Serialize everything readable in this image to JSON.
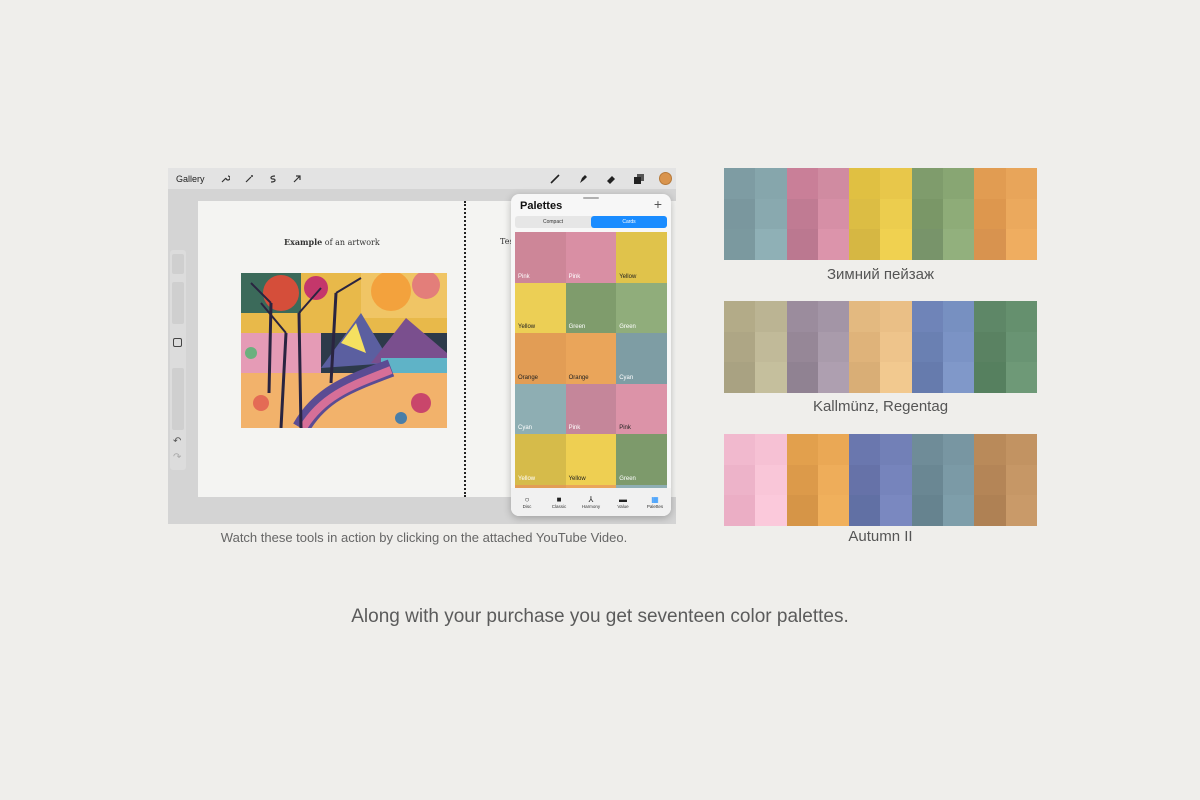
{
  "toolbar": {
    "gallery_label": "Gallery",
    "current_color": "#d9944d"
  },
  "canvas": {
    "caption_bold": "Example",
    "caption_rest": " of an artwork",
    "caption_right": "Tes"
  },
  "palettes_panel": {
    "title": "Palettes",
    "add_icon": "plus-icon",
    "view_modes": [
      "Compact",
      "Cards"
    ],
    "active_view": "Cards",
    "cards": [
      {
        "label": "Pink",
        "color": "#cd8698",
        "text": "#ffffff"
      },
      {
        "label": "Pink",
        "color": "#d98fa4",
        "text": "#ffffff"
      },
      {
        "label": "Yellow",
        "color": "#e0c34b",
        "text": "#222222"
      },
      {
        "label": "Yellow",
        "color": "#eccf55",
        "text": "#222222"
      },
      {
        "label": "Green",
        "color": "#7f9c6c",
        "text": "#ffffff"
      },
      {
        "label": "Green",
        "color": "#90ad7b",
        "text": "#ffffff"
      },
      {
        "label": "Orange",
        "color": "#e29d55",
        "text": "#222222"
      },
      {
        "label": "Orange",
        "color": "#eaa55a",
        "text": "#222222"
      },
      {
        "label": "Cyan",
        "color": "#7e9da4",
        "text": "#ffffff"
      },
      {
        "label": "Cyan",
        "color": "#8eaeb3",
        "text": "#ffffff"
      },
      {
        "label": "Pink",
        "color": "#c5869a",
        "text": "#ffffff"
      },
      {
        "label": "Pink",
        "color": "#dc93a8",
        "text": "#222222"
      },
      {
        "label": "Yellow",
        "color": "#d6bb4a",
        "text": "#ffffff"
      },
      {
        "label": "Yellow",
        "color": "#eecf52",
        "text": "#222222"
      },
      {
        "label": "Green",
        "color": "#7d9a6b",
        "text": "#ffffff"
      },
      {
        "label": "",
        "color": "#e29d55",
        "text": "#222222"
      },
      {
        "label": "",
        "color": "#eaa55a",
        "text": "#222222"
      },
      {
        "label": "",
        "color": "#8eaeb3",
        "text": "#222222"
      }
    ],
    "tabs": [
      {
        "label": "Disc",
        "icon": "disc-icon",
        "glyph": "○"
      },
      {
        "label": "Classic",
        "icon": "classic-icon",
        "glyph": "■"
      },
      {
        "label": "Harmony",
        "icon": "harmony-icon",
        "glyph": "⅄"
      },
      {
        "label": "Value",
        "icon": "value-icon",
        "glyph": "▬"
      },
      {
        "label": "Palettes",
        "icon": "palettes-icon",
        "glyph": "▦"
      }
    ],
    "active_tab": "Palettes"
  },
  "video_caption": "Watch these tools in action by clicking on the attached YouTube Video.",
  "palettes": [
    {
      "name": "Зимний пейзаж",
      "groups": [
        [
          "#7e9ca3",
          "#86a6ac",
          "#7a979e",
          "#89a9af",
          "#7b999f",
          "#8fb0b6"
        ],
        [
          "#c97f98",
          "#d08ba1",
          "#c07b93",
          "#d68fa6",
          "#bb7890",
          "#dc94ab"
        ],
        [
          "#e0c042",
          "#e8c74a",
          "#dcbd44",
          "#eccd4e",
          "#d6b743",
          "#f0d150"
        ],
        [
          "#7f9c6c",
          "#88a673",
          "#7a9767",
          "#8eac78",
          "#78946a",
          "#92b07d"
        ],
        [
          "#e19c52",
          "#e8a55a",
          "#dd974e",
          "#eba95d",
          "#d8934f",
          "#efad60"
        ]
      ]
    },
    {
      "name": "Kallmünz, Regentag",
      "groups": [
        [
          "#b3ab88",
          "#bbb493",
          "#aea685",
          "#c1ba99",
          "#a9a282",
          "#c5bf9d"
        ],
        [
          "#9b8c9d",
          "#a395a6",
          "#968797",
          "#a99bab",
          "#908292",
          "#ae9fb0"
        ],
        [
          "#e3b980",
          "#eabf86",
          "#dfb37a",
          "#eec48b",
          "#d9ae76",
          "#f2c98f"
        ],
        [
          "#6f84b8",
          "#7790c1",
          "#6a80b2",
          "#7b93c5",
          "#667bad",
          "#8098c9"
        ],
        [
          "#5e8767",
          "#65906e",
          "#5a8262",
          "#699473",
          "#56805f",
          "#6e9977"
        ]
      ]
    },
    {
      "name": "Autumn II",
      "groups": [
        [
          "#f1b9ce",
          "#f6c1d4",
          "#edb3c9",
          "#f9c6d8",
          "#ebaec5",
          "#fbc9db"
        ],
        [
          "#e2a04d",
          "#eaa855",
          "#dc9a4a",
          "#eead5a",
          "#d69547",
          "#f0b05c"
        ],
        [
          "#6a77ae",
          "#7280b7",
          "#6672a8",
          "#7684bc",
          "#6170a4",
          "#7a88c0"
        ],
        [
          "#6f8c98",
          "#7896a2",
          "#6a8793",
          "#7b9aa6",
          "#66838f",
          "#7e9eaa"
        ],
        [
          "#b98a5a",
          "#c29362",
          "#b48557",
          "#c69766",
          "#af8154",
          "#c99a69"
        ]
      ]
    }
  ],
  "footer": "Along with your purchase you get seventeen color palettes."
}
